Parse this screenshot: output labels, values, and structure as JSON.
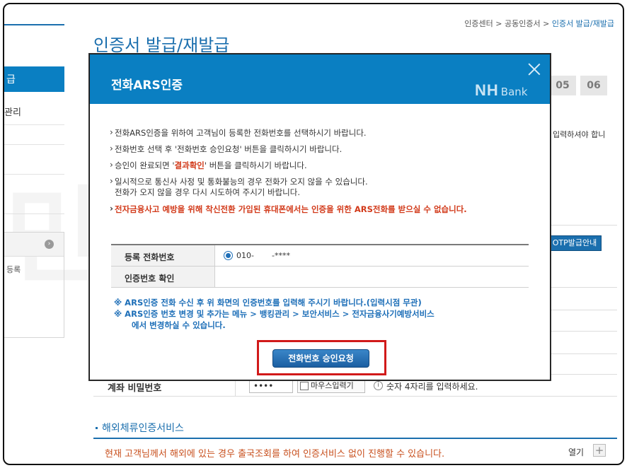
{
  "breadcrumb": {
    "items": [
      "인증센터",
      "공동인증서",
      "인증서 발급/재발급"
    ],
    "separator": ">"
  },
  "page_title": "인증서 발급/재발급",
  "sidebar": {
    "active_label": "급",
    "item_manage": "관리",
    "box_text": "등록",
    "box_icon": "chevron-right-circle-icon"
  },
  "steps": [
    "05",
    "06"
  ],
  "background": {
    "right_text": "입력하셔야 합니",
    "otp_button": "OTP발급안내",
    "password_row": {
      "label": "계좌 비밀번호",
      "value": "••••",
      "mouse_input_label": "마우스입력기",
      "info": "숫자 4자리를 입력하세요."
    },
    "section2_title": "해외체류인증서비스",
    "notice": "현재 고객님께서 해외에 있는 경우 출국조회를 하여 인증서비스 없이 진행할 수 있습니다.",
    "open_label": "열기",
    "open_icon": "plus-icon",
    "watermark": "민원인드"
  },
  "modal": {
    "title": "전화ARS인증",
    "logo_nh": "NH",
    "logo_bank": "Bank",
    "close_icon": "close-icon",
    "instructions": {
      "i1": "전화ARS인증을 위하여 고객님이 등록한 전화번호를 선택하시기 바랍니다.",
      "i2": "전화번호 선택 후 '전화번호 승인요청' 버튼을 클릭하시기 바랍니다.",
      "i3_pre": "승인이 완료되면 '",
      "i3_hl": "결과확인",
      "i3_post": "' 버튼을 클릭하시기 바랍니다.",
      "i4_line1": "일시적으로 통신사 사정 및 통화불능의 경우 전화가 오지 않을 수 있습니다.",
      "i4_line2": "전화가 오지 않을 경우 다시 시도하여 주시기 바랍니다.",
      "warning": "전자금융사고 예방을 위해 착신전환 가입된 휴대폰에서는 인증을 위한 ARS전화를 받으실 수 없습니다."
    },
    "table": {
      "phone_label": "등록 전화번호",
      "phone_prefix": "010-",
      "phone_masked": "-****",
      "verify_label": "인증번호 확인"
    },
    "notes": {
      "n1": "※ ARS인증 전화 수신 후 위 화면의 인증번호를 입력해 주시기 바랍니다.(입력시점 무관)",
      "n2a": "※ ARS인증 번호 변경 및 추가는 메뉴 > 뱅킹관리 > 보안서비스 > 전자금융사기예방서비스",
      "n2b": "에서 변경하실 수 있습니다."
    },
    "request_button": "전화번호 승인요청"
  },
  "colors": {
    "primary": "#0a7fc2",
    "title_blue": "#1b6fae",
    "warning_red": "#d23a1a",
    "highlight_box": "#d11a1a",
    "notice_orange": "#c8501e"
  }
}
